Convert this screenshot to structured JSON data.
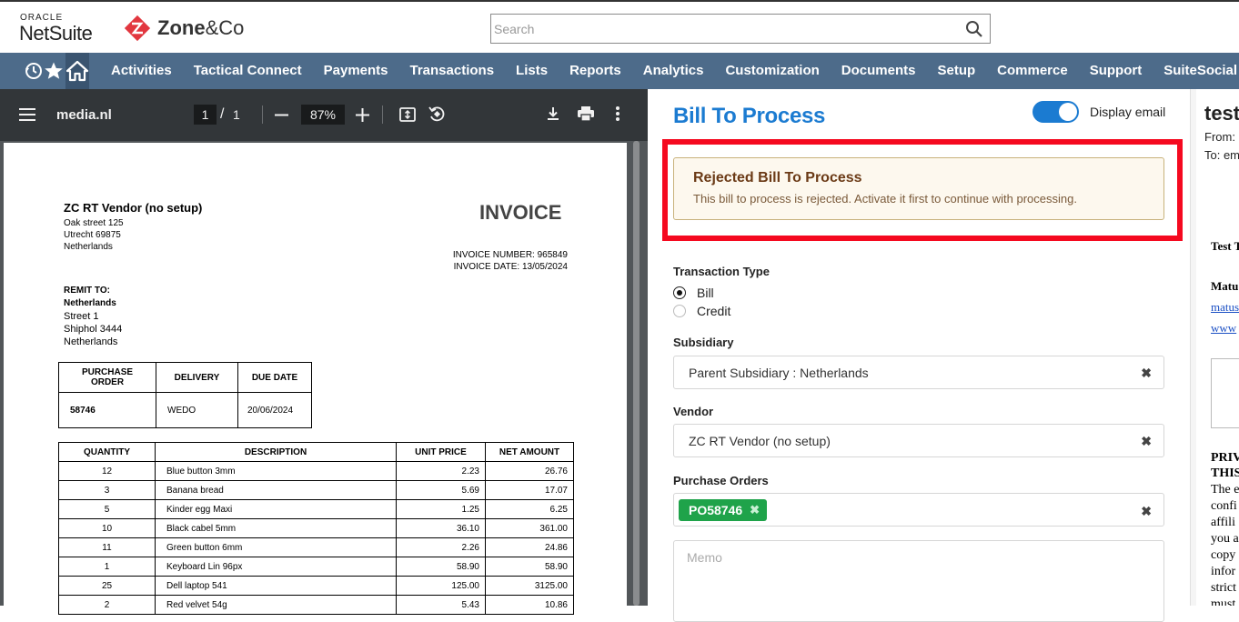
{
  "header": {
    "oracle_label": "ORACLE",
    "netsuite_label": "NetSuite",
    "partner_brand_bold": "Zone",
    "partner_brand_rest": "&Co",
    "search_placeholder": "Search"
  },
  "nav": {
    "items": [
      "Activities",
      "Tactical Connect",
      "Payments",
      "Transactions",
      "Lists",
      "Reports",
      "Analytics",
      "Customization",
      "Documents",
      "Setup",
      "Commerce",
      "Support",
      "SuiteSocial"
    ]
  },
  "pdf_toolbar": {
    "filename": "media.nl",
    "page_current": "1",
    "page_sep": "/",
    "page_total": "1",
    "zoom": "87%"
  },
  "invoice": {
    "vendor_name": "ZC RT Vendor (no setup)",
    "vendor_address": [
      "Oak street 125",
      "Utrecht 69875",
      "Netherlands"
    ],
    "title": "INVOICE",
    "number_line": "INVOICE NUMBER: 965849",
    "date_line": "INVOICE DATE: 13/05/2024",
    "remit_label": "REMIT TO:",
    "remit_name": "Netherlands",
    "remit_address": [
      "Street 1",
      "Shiphol 3444",
      "Netherlands"
    ],
    "po_headers": [
      "PURCHASE ORDER",
      "DELIVERY",
      "DUE DATE"
    ],
    "po_row": [
      "58746",
      "WEDO",
      "20/06/2024"
    ],
    "line_headers": [
      "QUANTITY",
      "DESCRIPTION",
      "UNIT PRICE",
      "NET AMOUNT"
    ],
    "lines": [
      [
        "12",
        "Blue button 3mm",
        "2.23",
        "26.76"
      ],
      [
        "3",
        "Banana bread",
        "5.69",
        "17.07"
      ],
      [
        "5",
        "Kinder egg Maxi",
        "1.25",
        "6.25"
      ],
      [
        "10",
        "Black cabel 5mm",
        "36.10",
        "361.00"
      ],
      [
        "11",
        "Green button 6mm",
        "2.26",
        "24.86"
      ],
      [
        "1",
        "Keyboard Lin 96px",
        "58.90",
        "58.90"
      ],
      [
        "25",
        "Dell laptop 541",
        "125.00",
        "3125.00"
      ],
      [
        "2",
        "Red velvet 54g",
        "5.43",
        "10.86"
      ]
    ]
  },
  "form": {
    "title": "Bill To Process",
    "display_email_label": "Display email",
    "alert_title": "Rejected Bill To Process",
    "alert_text": "This bill to process is rejected. Activate it first to continue with processing.",
    "transaction_type_label": "Transaction Type",
    "transaction_options": [
      "Bill",
      "Credit"
    ],
    "subsidiary_label": "Subsidiary",
    "subsidiary_value": "Parent Subsidiary : Netherlands",
    "vendor_label": "Vendor",
    "vendor_value": "ZC RT Vendor (no setup)",
    "purchase_orders_label": "Purchase Orders",
    "purchase_order_tag": "PO58746",
    "memo_placeholder": "Memo",
    "clear_symbol": "✖"
  },
  "email_preview": {
    "subject": "test",
    "from_label": "From:",
    "to_label": "To: em",
    "line1": "Test T",
    "line2": "Matu",
    "link1": "matus",
    "link2": "www",
    "priv1": "PRIV",
    "priv2": "THIS",
    "body": [
      "The e",
      "confi",
      "affili",
      "you a",
      "copy",
      "infor",
      "strict",
      "must"
    ]
  }
}
